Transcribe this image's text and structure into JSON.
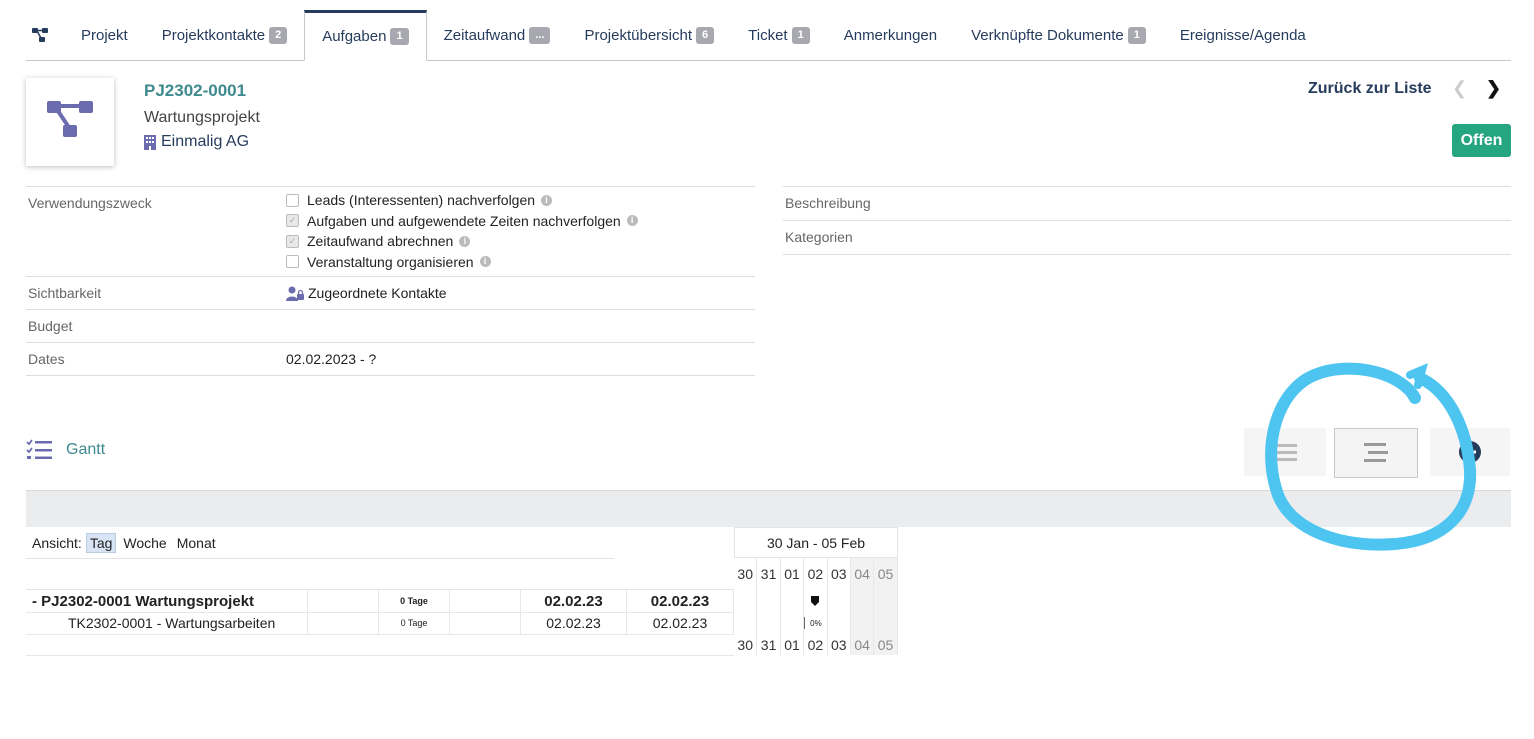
{
  "tabs": [
    {
      "label": "Projekt",
      "badge": ""
    },
    {
      "label": "Projektkontakte",
      "badge": "2"
    },
    {
      "label": "Aufgaben",
      "badge": "1"
    },
    {
      "label": "Zeitaufwand",
      "badge": "..."
    },
    {
      "label": "Projektübersicht",
      "badge": "6"
    },
    {
      "label": "Ticket",
      "badge": "1"
    },
    {
      "label": "Anmerkungen",
      "badge": ""
    },
    {
      "label": "Verknüpfte Dokumente",
      "badge": "1"
    },
    {
      "label": "Ereignisse/Agenda",
      "badge": ""
    }
  ],
  "header": {
    "ref": "PJ2302-0001",
    "name": "Wartungsprojekt",
    "company": "Einmalig AG",
    "back": "Zurück zur Liste",
    "status": "Offen"
  },
  "fields": {
    "purpose_label": "Verwendungszweck",
    "purpose_options": [
      {
        "label": "Leads (Interessenten) nachverfolgen",
        "checked": false
      },
      {
        "label": "Aufgaben und aufgewendete Zeiten nachverfolgen",
        "checked": true
      },
      {
        "label": "Zeitaufwand abrechnen",
        "checked": true
      },
      {
        "label": "Veranstaltung organisieren",
        "checked": false
      }
    ],
    "visibility_label": "Sichtbarkeit",
    "visibility_value": "Zugeordnete Kontakte",
    "budget_label": "Budget",
    "budget_value": "",
    "dates_label": "Dates",
    "dates_value": "02.02.2023 - ?",
    "description_label": "Beschreibung",
    "categories_label": "Kategorien"
  },
  "gantt": {
    "title": "Gantt",
    "view_label": "Ansicht:",
    "view_options": [
      "Tag",
      "Woche",
      "Monat"
    ],
    "selected_view": "Tag",
    "week_range": "30 Jan - 05 Feb",
    "days": [
      "30",
      "31",
      "01",
      "02",
      "03",
      "04",
      "05"
    ],
    "rows": [
      {
        "name": "- PJ2302-0001 Wartungsprojekt",
        "duration": "0 Tage",
        "start": "02.02.23",
        "end": "02.02.23",
        "progress": "",
        "bold": true
      },
      {
        "name": "TK2302-0001 - Wartungsarbeiten",
        "duration": "0 Tage",
        "start": "02.02.23",
        "end": "02.02.23",
        "progress": "0%",
        "bold": false
      }
    ]
  },
  "colors": {
    "accent": "#263c5c",
    "teal": "#3e8a8e",
    "status_green": "#25a580",
    "annotation": "#4ec5f0"
  }
}
